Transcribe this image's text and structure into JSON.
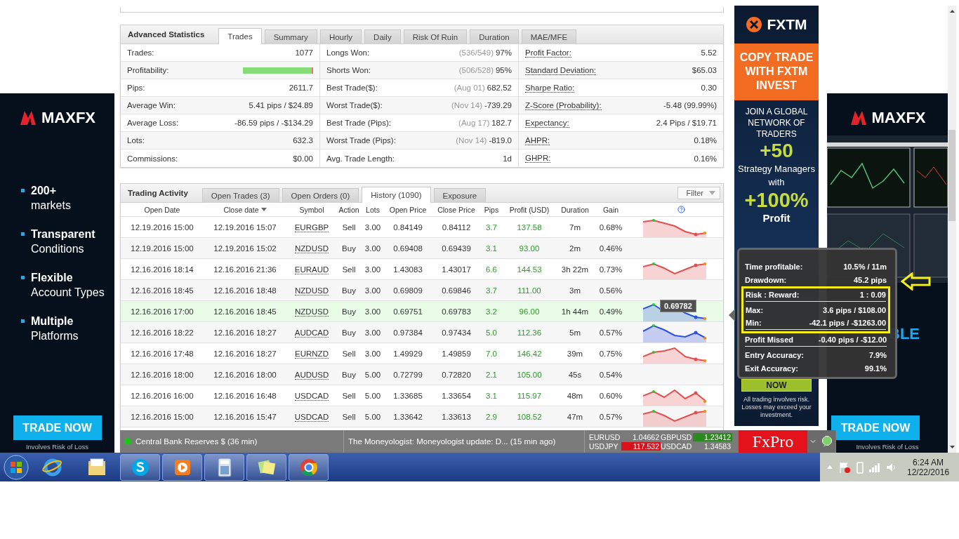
{
  "statistics": {
    "title": "Advanced Statistics",
    "tabs": [
      {
        "label": "Trades",
        "selected": true
      },
      {
        "label": "Summary",
        "selected": false
      },
      {
        "label": "Hourly",
        "selected": false
      },
      {
        "label": "Daily",
        "selected": false
      },
      {
        "label": "Risk Of Ruin",
        "selected": false
      },
      {
        "label": "Duration",
        "selected": false
      },
      {
        "label": "MAE/MFE",
        "selected": false
      }
    ],
    "columns": [
      [
        {
          "kind": "plain",
          "label": "Trades:",
          "value": "1077"
        },
        {
          "kind": "bar",
          "label": "Profitability:",
          "level": 0.98
        },
        {
          "kind": "plain",
          "label": "Pips:",
          "value": "2611.7"
        },
        {
          "kind": "plain",
          "label": "Average Win:",
          "value": "5.41 pips / $24.89"
        },
        {
          "kind": "plain",
          "label": "Average Loss:",
          "value": "-86.59 pips / -$134.29"
        },
        {
          "kind": "plain",
          "label": "Lots:",
          "value": "632.3"
        },
        {
          "kind": "plain",
          "label": "Commissions:",
          "value": "$0.00"
        }
      ],
      [
        {
          "kind": "plain",
          "label": "Longs Won:",
          "note": "(536/549)",
          "value": "97%"
        },
        {
          "kind": "plain",
          "label": "Shorts Won:",
          "note": "(506/528)",
          "value": "95%"
        },
        {
          "kind": "plain",
          "label": "Best Trade($):",
          "note": "(Aug 01)",
          "value": "682.52"
        },
        {
          "kind": "plain",
          "label": "Worst Trade($):",
          "note": "(Nov 14)",
          "value": "-739.29"
        },
        {
          "kind": "plain",
          "label": "Best Trade (Pips):",
          "note": "(Aug 17)",
          "value": "182.7"
        },
        {
          "kind": "plain",
          "label": "Worst Trade (Pips):",
          "note": "(Nov 14)",
          "value": "-819.0"
        },
        {
          "kind": "plain",
          "label": "Avg. Trade Length:",
          "value": "1d"
        }
      ],
      [
        {
          "kind": "link",
          "label": "Profit Factor:",
          "value": "5.52"
        },
        {
          "kind": "link",
          "label": "Standard Deviation:",
          "value": "$65.03"
        },
        {
          "kind": "link",
          "label": "Sharpe Ratio:",
          "value": "0.30"
        },
        {
          "kind": "link",
          "label": "Z-Score (Probability):",
          "value": "-5.48 (99.99%)"
        },
        {
          "kind": "link",
          "label": "Expectancy:",
          "value": "2.4 Pips / $19.71"
        },
        {
          "kind": "link",
          "label": "AHPR:",
          "value": "0.18%"
        },
        {
          "kind": "link",
          "label": "GHPR:",
          "value": "0.16%"
        }
      ]
    ]
  },
  "trading_activity": {
    "title": "Trading Activity",
    "tabs": [
      {
        "label": "Open Trades (3)",
        "selected": false
      },
      {
        "label": "Open Orders (0)",
        "selected": false
      },
      {
        "label": "History (1090)",
        "selected": true
      },
      {
        "label": "Exposure",
        "selected": false
      }
    ],
    "filter": "Filter",
    "columns": [
      "Open Date",
      "Close date",
      "Symbol",
      "Action",
      "Lots",
      "Open Price",
      "Close Price",
      "Pips",
      "Profit (USD)",
      "Duration",
      "Gain"
    ],
    "rows": [
      {
        "selected": false,
        "cells": [
          "12.19.2016 15:00",
          "12.19.2016 15:07",
          "EURGBP",
          "Sell",
          "3.00",
          "0.84149",
          "0.84112",
          "3.7",
          "137.58",
          "7m",
          "0.68%"
        ],
        "sparkline": {
          "color": "#e05050"
        }
      },
      {
        "selected": false,
        "cells": [
          "12.19.2016 15:00",
          "12.19.2016 15:02",
          "NZDUSD",
          "Buy",
          "3.00",
          "0.69408",
          "0.69439",
          "3.1",
          "93.00",
          "2m",
          "0.46%"
        ]
      },
      {
        "selected": false,
        "cells": [
          "12.16.2016 18:14",
          "12.16.2016 21:36",
          "EURAUD",
          "Sell",
          "3.00",
          "1.43083",
          "1.43017",
          "6.6",
          "144.53",
          "3h 22m",
          "0.73%"
        ],
        "sparkline": {
          "color": "#e05050"
        }
      },
      {
        "selected": false,
        "cells": [
          "12.16.2016 18:45",
          "12.16.2016 18:48",
          "NZDUSD",
          "Buy",
          "3.00",
          "0.69809",
          "0.69846",
          "3.7",
          "111.00",
          "3m",
          "0.56%"
        ]
      },
      {
        "selected": true,
        "cells": [
          "12.16.2016 17:00",
          "12.16.2016 18:45",
          "NZDUSD",
          "Buy",
          "3.00",
          "0.69751",
          "0.69783",
          "3.2",
          "96.00",
          "1h 44m",
          "0.49%"
        ],
        "sparkline": {
          "color": "#3050e0",
          "tooltip": "0.69782"
        }
      },
      {
        "selected": false,
        "cells": [
          "12.16.2016 18:22",
          "12.16.2016 18:27",
          "AUDCAD",
          "Buy",
          "3.00",
          "0.97384",
          "0.97434",
          "5.0",
          "112.36",
          "5m",
          "0.57%"
        ],
        "sparkline": {
          "color": "#3050e0"
        }
      },
      {
        "selected": false,
        "cells": [
          "12.16.2016 17:48",
          "12.16.2016 18:27",
          "EURNZD",
          "Sell",
          "3.00",
          "1.49929",
          "1.49859",
          "7.0",
          "146.42",
          "39m",
          "0.75%"
        ],
        "sparkline": {
          "color": "#e05050"
        }
      },
      {
        "selected": false,
        "cells": [
          "12.16.2016 18:00",
          "12.16.2016 18:00",
          "AUDUSD",
          "Buy",
          "5.00",
          "0.72799",
          "0.72820",
          "2.1",
          "105.00",
          "45s",
          "0.54%"
        ]
      },
      {
        "selected": false,
        "cells": [
          "12.16.2016 16:00",
          "12.16.2016 16:48",
          "USDCAD",
          "Sell",
          "5.00",
          "1.33685",
          "1.33654",
          "3.1",
          "115.97",
          "48m",
          "0.60%"
        ],
        "sparkline": {
          "color": "#e05050"
        }
      },
      {
        "selected": false,
        "cells": [
          "12.16.2016 15:00",
          "12.16.2016 15:47",
          "USDCAD",
          "Sell",
          "5.00",
          "1.33642",
          "1.33613",
          "2.9",
          "108.52",
          "47m",
          "0.57%"
        ],
        "sparkline": {
          "color": "#e05050"
        }
      }
    ]
  },
  "trade_tooltip": {
    "rows": [
      {
        "label": "Time profitable:",
        "value": "10.5% / 11m",
        "highlighted": false,
        "divider_after": false
      },
      {
        "label": "Drawdown:",
        "value": "45.2 pips",
        "highlighted": false,
        "divider_after": false
      },
      {
        "label": "Risk : Reward:",
        "value": "1 : 0.09",
        "highlighted": true,
        "divider_after": true
      },
      {
        "label": "Max:",
        "value": "3.6 pips / $108.00",
        "highlighted": true,
        "divider_after": false
      },
      {
        "label": "Min:",
        "value": "-42.1 pips / -$1263.00",
        "highlighted": true,
        "divider_after": true
      },
      {
        "label": "Profit Missed",
        "value": "-0.40 pips / -$12.00",
        "highlighted": false,
        "divider_after": true
      },
      {
        "label": "Entry Accuracy:",
        "value": "7.9%",
        "highlighted": false,
        "divider_after": false
      },
      {
        "label": "Exit Accuracy:",
        "value": "99.1%",
        "highlighted": false,
        "divider_after": false
      }
    ]
  },
  "left_ad": {
    "brand": "MAXFX",
    "bullets": [
      {
        "strong": "200+",
        "text": "markets"
      },
      {
        "strong": "Transparent",
        "text": "Conditions"
      },
      {
        "strong": "Flexible",
        "text": "Account Types"
      },
      {
        "strong": "Multiple",
        "text": "Platforms"
      }
    ],
    "button": "TRADE NOW",
    "disclaimer": "Involves Risk of Loss"
  },
  "fxtm_ad": {
    "brand": "FXTM",
    "headline": "COPY TRADE WITH FXTM INVEST",
    "intro": "JOIN A GLOBAL NETWORK OF TRADERS",
    "big_1": "+50",
    "middle": "Strategy Managers with",
    "big_2": "+100%",
    "tail": "Profit",
    "button": "NOW",
    "disclaimer": "All trading involves risk. Losses may exceed your investment."
  },
  "right_ad": {
    "brand": "MAXFX",
    "fragment": "BLE",
    "button": "TRADE NOW",
    "disclaimer": "Involves Risk of Loss"
  },
  "ticker": {
    "news": [
      {
        "text": "Central Bank Reserves $ (36 min)",
        "live": true
      },
      {
        "text": "The Moneyologist: Moneyologist update: D...  (15 min ago)"
      }
    ],
    "quotes": [
      {
        "symbol": "EURUSD",
        "price": "1.04662"
      },
      {
        "symbol": "USDJPY",
        "price": "117.532",
        "color": "#d8121c"
      },
      {
        "symbol": "GBPUSD",
        "price": "1.23412",
        "color": "#2b8a1e"
      },
      {
        "symbol": "USDCAD",
        "price": "1.34583"
      }
    ],
    "brand": "FxPro"
  },
  "taskbar": {
    "apps": [
      {
        "kind": "ie",
        "running": false
      },
      {
        "kind": "explorer",
        "running": false
      },
      {
        "kind": "skype",
        "running": true
      },
      {
        "kind": "media",
        "running": true
      },
      {
        "kind": "calculator",
        "running": true
      },
      {
        "kind": "notes",
        "running": true
      },
      {
        "kind": "chrome",
        "running": true
      }
    ],
    "time": "6:24 AM",
    "date": "12/22/2016"
  }
}
